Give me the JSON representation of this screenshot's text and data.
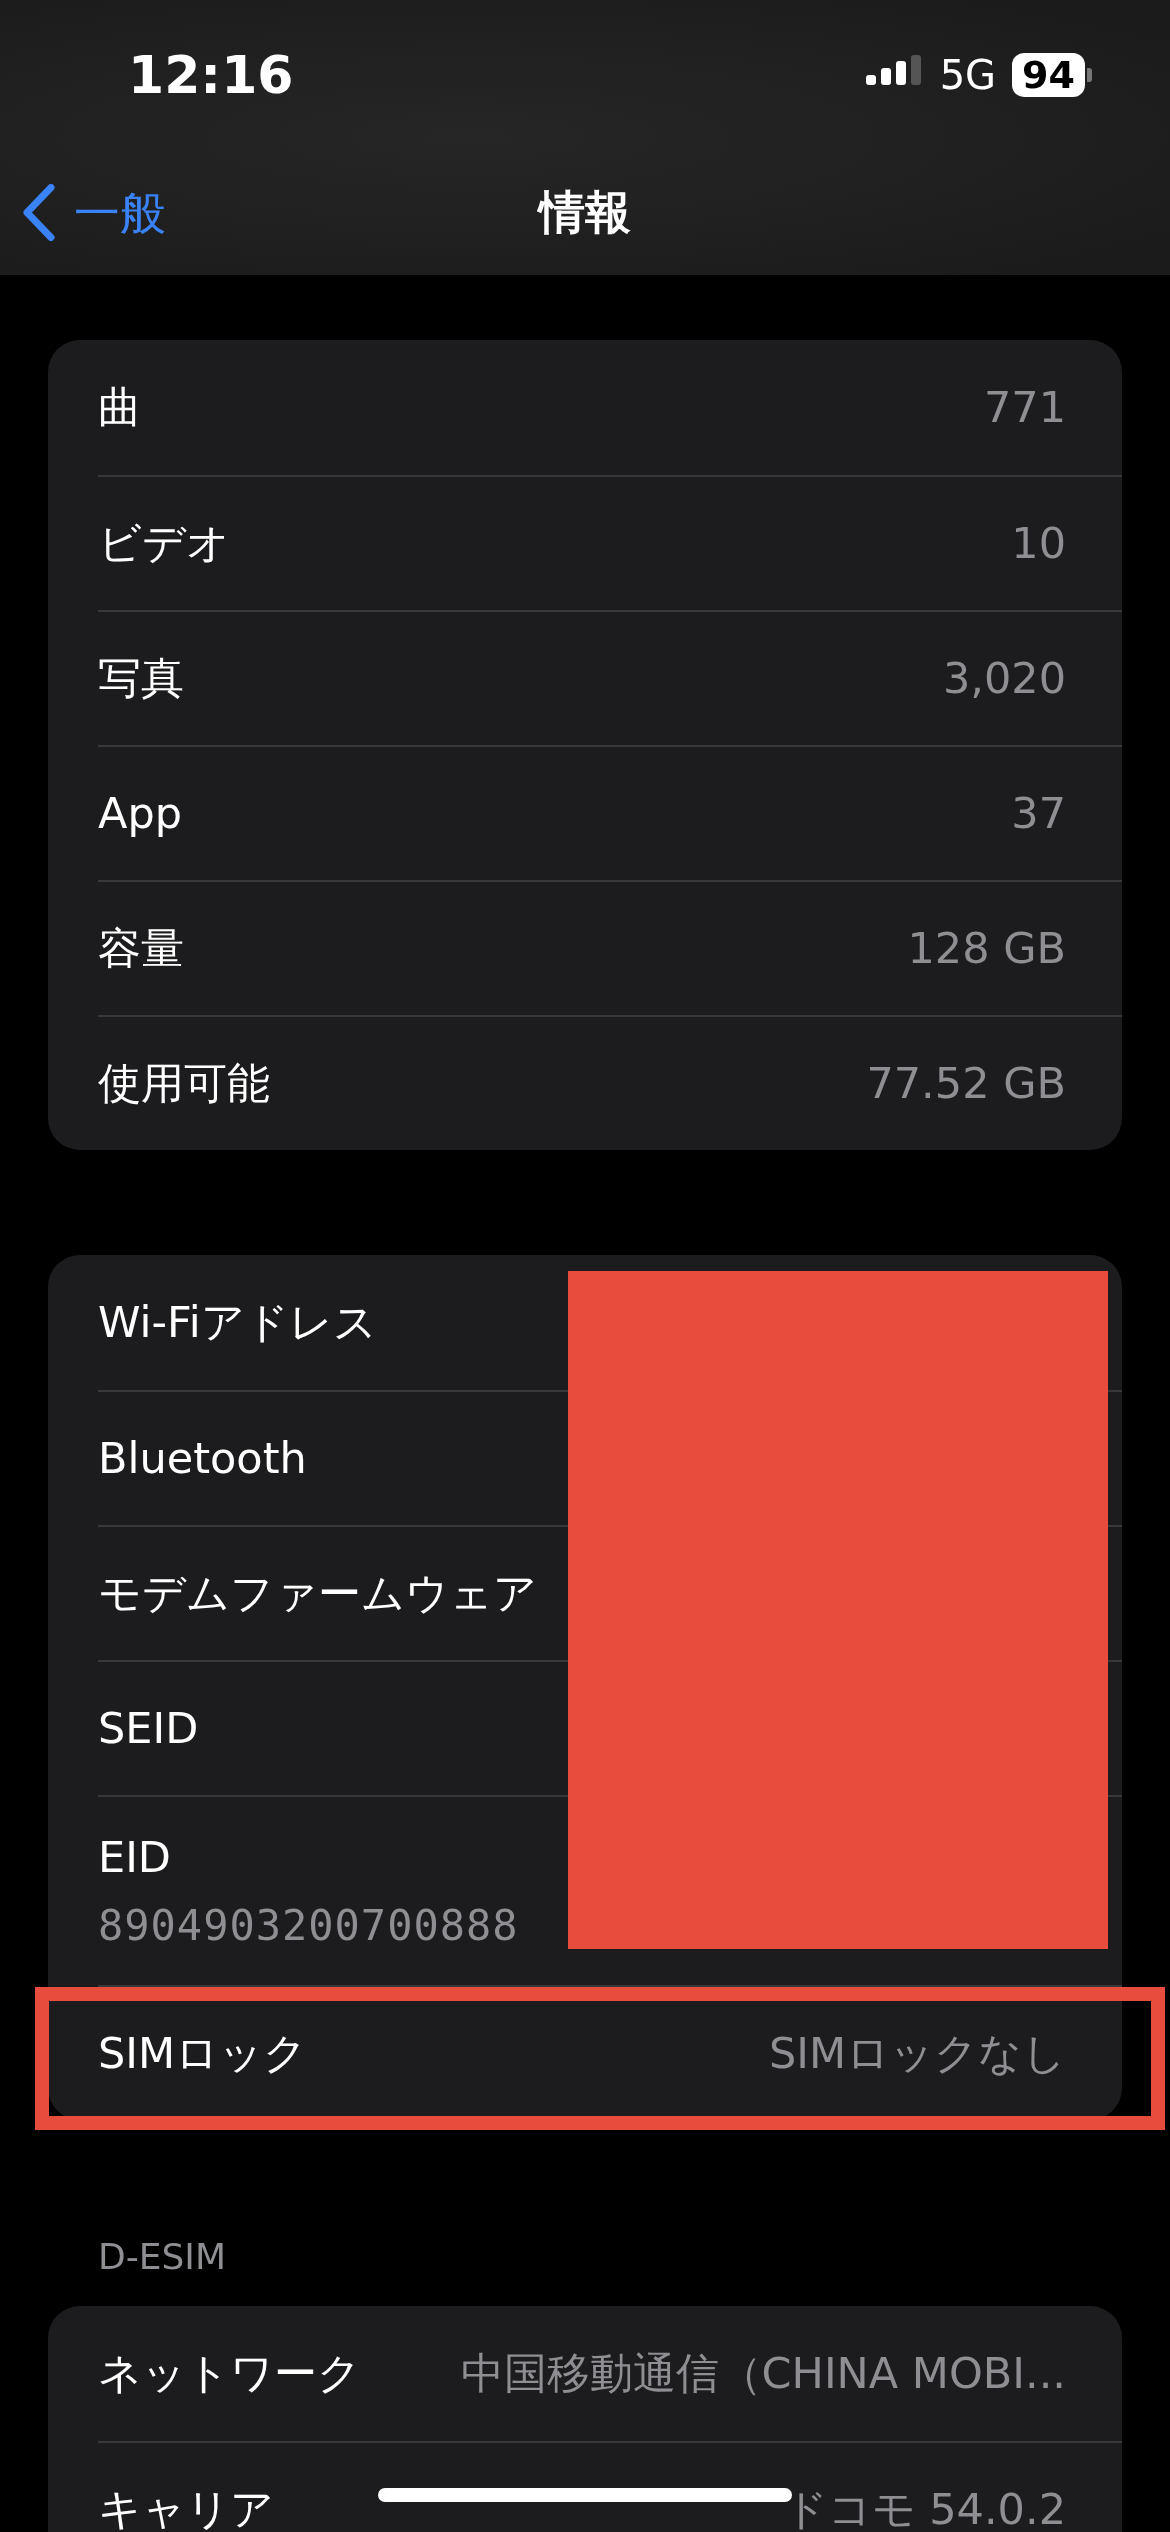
{
  "status_bar": {
    "time": "12:16",
    "network": "5G",
    "battery": "94"
  },
  "nav": {
    "back": "一般",
    "title": "情報"
  },
  "sections": [
    {
      "redacted": false,
      "rows": [
        {
          "kind": "inline",
          "label": "曲",
          "value": "771"
        },
        {
          "kind": "inline",
          "label": "ビデオ",
          "value": "10"
        },
        {
          "kind": "inline",
          "label": "写真",
          "value": "3,020"
        },
        {
          "kind": "inline",
          "label": "App",
          "value": "37"
        },
        {
          "kind": "inline",
          "label": "容量",
          "value": "128 GB"
        },
        {
          "kind": "inline",
          "label": "使用可能",
          "value": "77.52 GB"
        }
      ]
    },
    {
      "redacted": true,
      "rows": [
        {
          "kind": "inline",
          "label": "Wi-Fiアドレス",
          "highlighted": false
        },
        {
          "kind": "inline",
          "label": "Bluetooth",
          "highlighted": false
        },
        {
          "kind": "inline",
          "label": "モデムファームウェア",
          "highlighted": false
        },
        {
          "kind": "inline",
          "label": "SEID",
          "highlighted": false
        },
        {
          "kind": "stacked",
          "label": "EID",
          "value": "8904903200700888",
          "highlighted": false
        },
        {
          "kind": "inline",
          "label": "SIMロック",
          "value": "SIMロックなし",
          "highlighted": true
        }
      ]
    },
    {
      "header": "D-ESIM",
      "redacted": false,
      "rows": [
        {
          "kind": "inline",
          "label": "ネットワーク",
          "value": "中国移動通信（CHINA MOBI..."
        },
        {
          "kind": "inline",
          "label": "キャリア",
          "value": "ドコモ 54.0.2"
        }
      ]
    }
  ]
}
